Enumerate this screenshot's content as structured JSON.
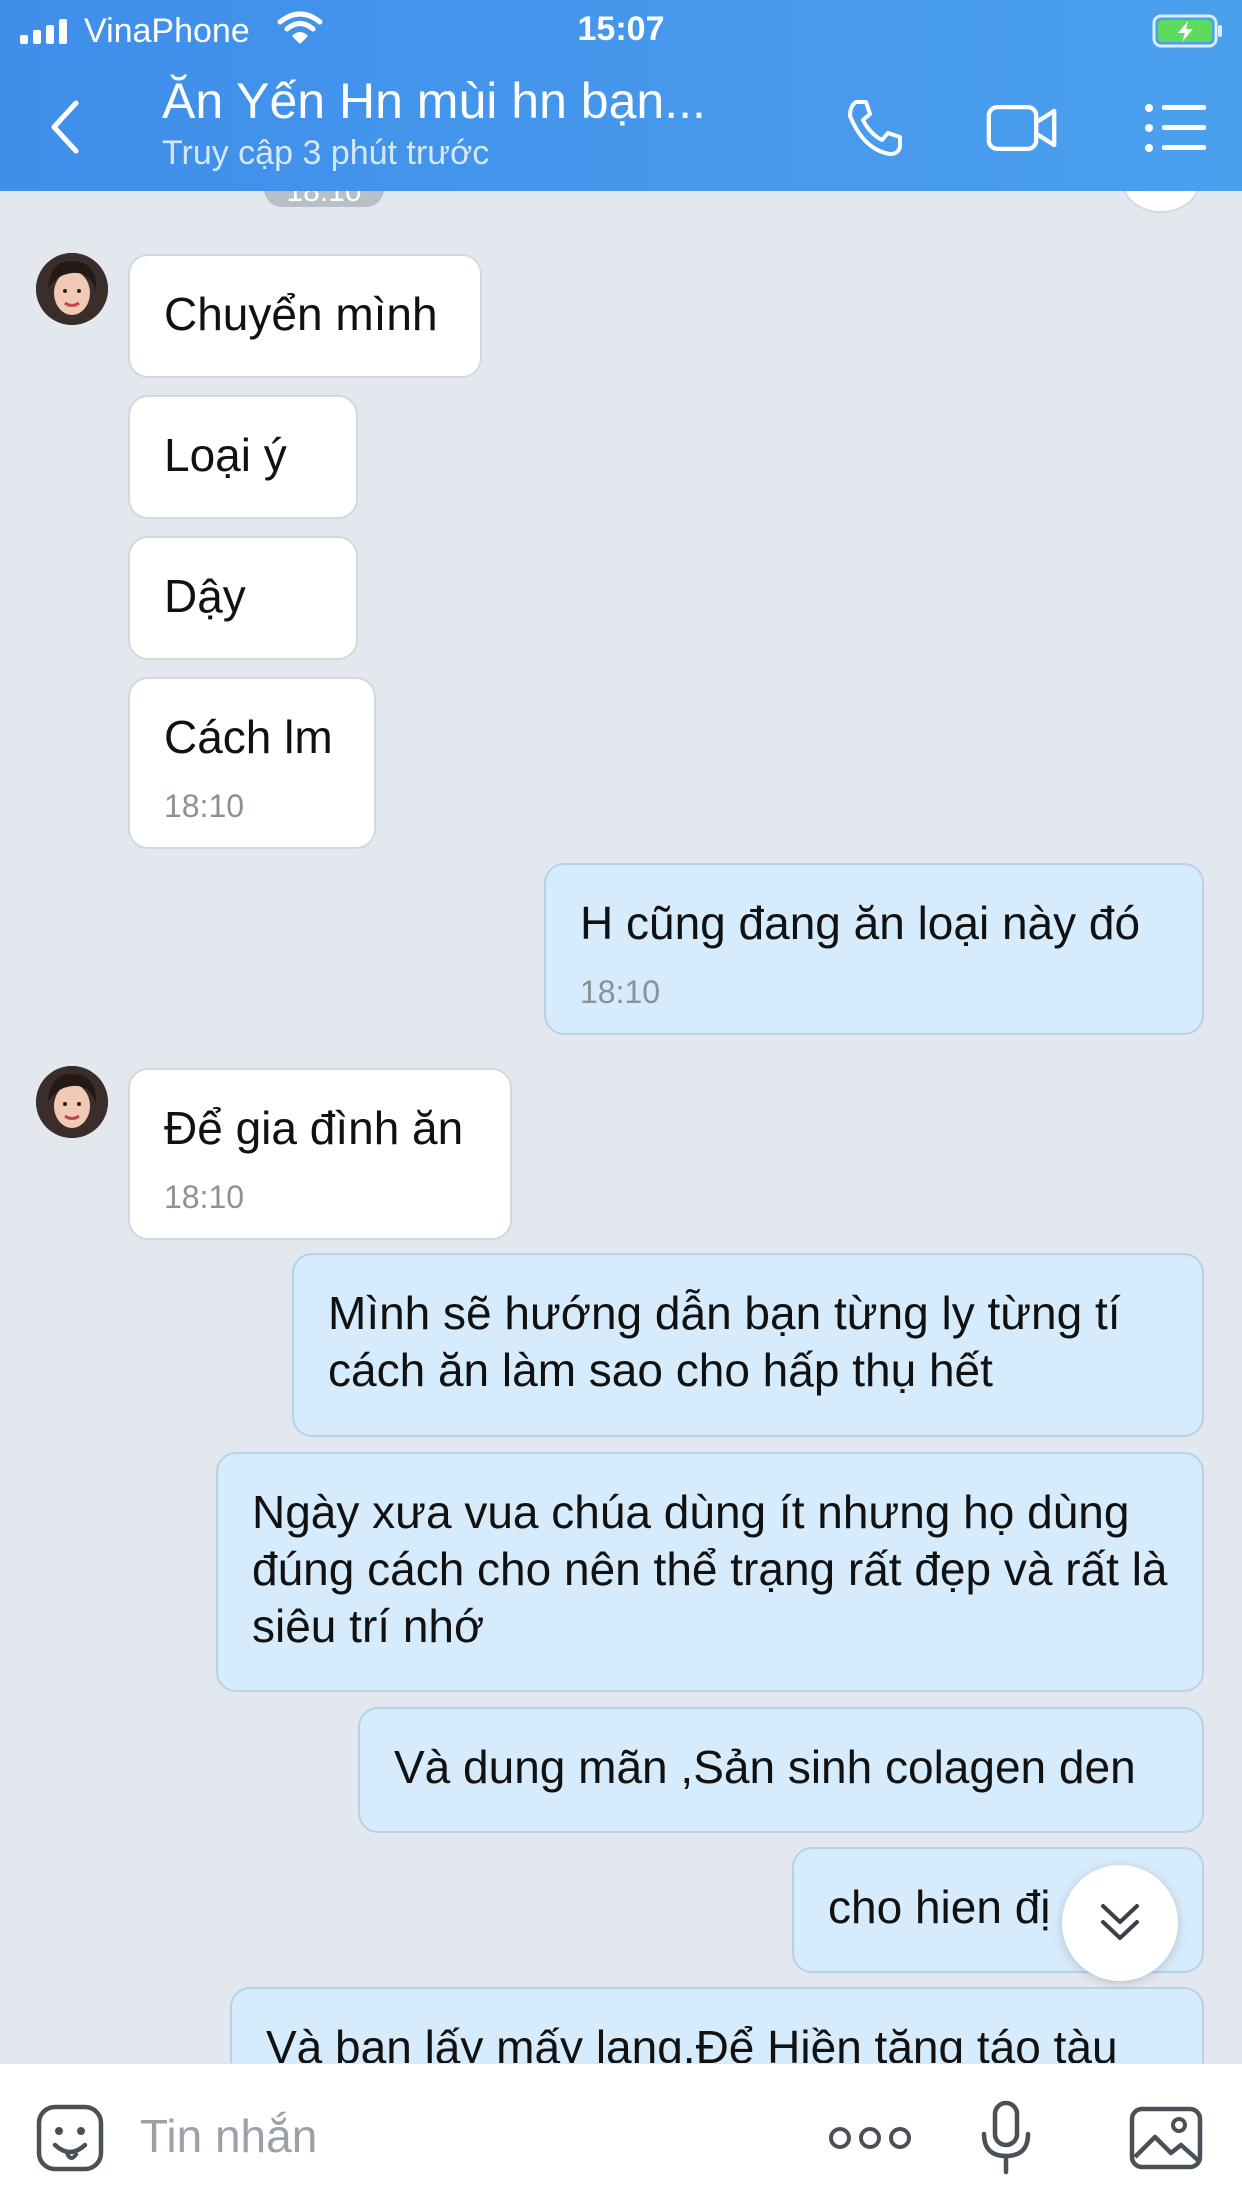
{
  "status_bar": {
    "carrier": "VinaPhone",
    "time": "15:07",
    "signal_bars": 4
  },
  "header": {
    "title": "Ăn Yến Hn mùi hn bạn...",
    "subtitle": "Truy cập 3 phút trước",
    "icons": [
      "back-arrow-icon",
      "phone-icon",
      "video-camera-icon",
      "menu-list-icon"
    ]
  },
  "chat": {
    "partial_time_top": "18:10",
    "messages": [
      {
        "side": "in",
        "text": "Chuyển mình",
        "time": ""
      },
      {
        "side": "in",
        "text": "Loại ý",
        "time": ""
      },
      {
        "side": "in",
        "text": "Dậy",
        "time": ""
      },
      {
        "side": "in",
        "text": "Cách lm",
        "time": "18:10"
      },
      {
        "side": "out",
        "text": "H cũng đang ăn loại này đó",
        "time": "18:10"
      },
      {
        "side": "in",
        "text": "Để gia đình ăn",
        "time": "18:10"
      },
      {
        "side": "out",
        "text": "Mình sẽ hướng dẫn bạn từng ly từng tí cách ăn làm sao cho hấp thụ hết",
        "time": ""
      },
      {
        "side": "out",
        "text": "Ngày xưa vua chúa dùng ít nhưng họ dùng đúng cách cho nên thể trạng rất đẹp và rất là siêu trí nhớ",
        "time": ""
      },
      {
        "side": "out",
        "text": "Và dung mãn ,Sản sinh colagen den",
        "time": ""
      },
      {
        "side": "out",
        "text": "cho hien đị",
        "time": ""
      },
      {
        "side": "out",
        "text": "Và ban lấy mấy lang.Để Hiền tặng táo tàu",
        "time": ""
      }
    ]
  },
  "input_bar": {
    "placeholder": "Tin nhắn",
    "icons": [
      "sticker-smile-icon",
      "more-dots-icon",
      "microphone-icon",
      "image-gallery-icon"
    ]
  },
  "colors": {
    "header_bg": "#4397ec",
    "chat_bg": "#e3e8ef",
    "incoming_bubble": "#ffffff",
    "outgoing_bubble": "#d6ebfb"
  }
}
